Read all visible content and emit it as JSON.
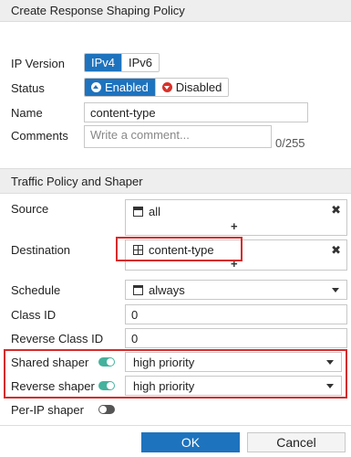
{
  "dialog": {
    "title": "Create Response Shaping Policy"
  },
  "ip_version": {
    "label": "IP Version",
    "options": [
      "IPv4",
      "IPv6"
    ],
    "selected": "IPv4"
  },
  "status": {
    "label": "Status",
    "enabled_label": "Enabled",
    "disabled_label": "Disabled",
    "selected": "Enabled"
  },
  "name": {
    "label": "Name",
    "value": "content-type"
  },
  "comments": {
    "label": "Comments",
    "placeholder": "Write a comment...",
    "counter": "0/255"
  },
  "section": {
    "title": "Traffic Policy and Shaper"
  },
  "source": {
    "label": "Source",
    "value": "all",
    "add_symbol": "+",
    "remove_symbol": "✖"
  },
  "destination": {
    "label": "Destination",
    "value": "content-type",
    "add_symbol": "+",
    "remove_symbol": "✖"
  },
  "schedule": {
    "label": "Schedule",
    "value": "always"
  },
  "class_id": {
    "label": "Class ID",
    "value": "0"
  },
  "reverse_class_id": {
    "label": "Reverse Class ID",
    "value": "0"
  },
  "shared_shaper": {
    "label": "Shared shaper",
    "enabled": true,
    "value": "high priority"
  },
  "reverse_shaper": {
    "label": "Reverse shaper",
    "enabled": true,
    "value": "high priority"
  },
  "per_ip_shaper": {
    "label": "Per-IP shaper",
    "enabled": false
  },
  "footer": {
    "ok_label": "OK",
    "cancel_label": "Cancel"
  },
  "colors": {
    "accent": "#1e73be",
    "toggle_on": "#45b29d",
    "highlight": "#d62b2b",
    "disabled_icon": "#d9302a"
  }
}
